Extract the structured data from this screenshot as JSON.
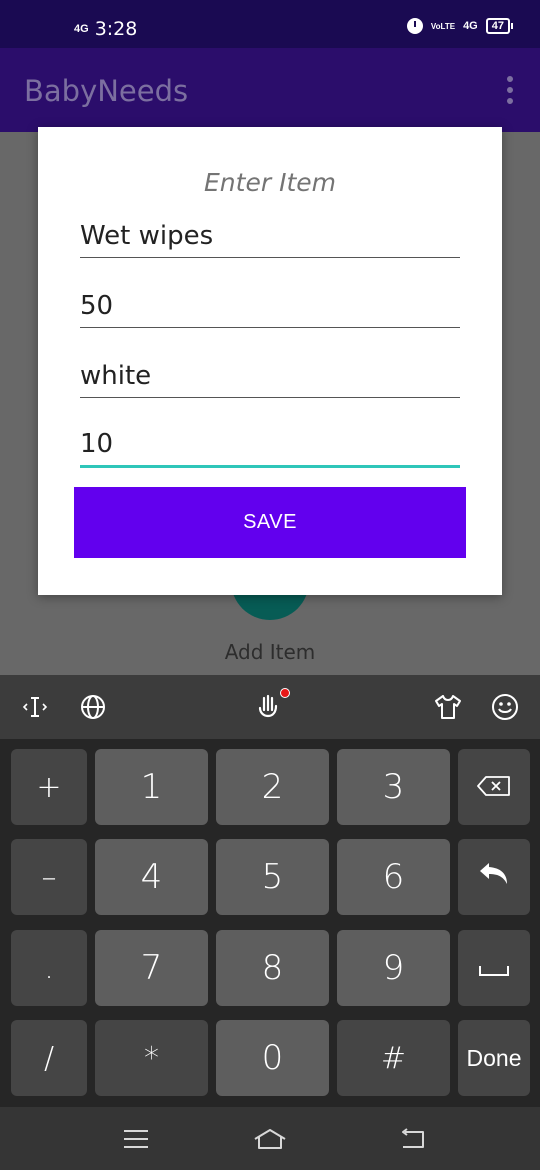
{
  "status_bar": {
    "network_left": "4G",
    "time": "3:28",
    "volte": "VoLTE",
    "network_right": "4G",
    "battery": "47"
  },
  "app_bar": {
    "title": "BabyNeeds"
  },
  "background": {
    "add_item_label": "Add Item"
  },
  "dialog": {
    "title": "Enter Item",
    "fields": [
      {
        "value": "Wet wipes"
      },
      {
        "value": "50"
      },
      {
        "value": "white"
      },
      {
        "value": "10"
      }
    ],
    "save_label": "SAVE"
  },
  "keyboard": {
    "side_left": [
      "+",
      "–",
      ".",
      "/"
    ],
    "numbers": [
      "1",
      "2",
      "3",
      "4",
      "5",
      "6",
      "7",
      "8",
      "9",
      "*",
      "0",
      "#"
    ],
    "done_label": "Done"
  },
  "colors": {
    "status_bar": "#1a0a52",
    "app_bar": "#2b0d6b",
    "save_button": "#6200ee",
    "focus_underline": "#2fc6b9",
    "fab": "#075c55"
  },
  "icons": {
    "toolbar": [
      "text-cursor-icon",
      "globe-icon",
      "voice-hand-icon",
      "theme-shirt-icon",
      "emoji-icon"
    ],
    "keyboard": [
      "backspace-icon",
      "enter-icon",
      "space-icon"
    ],
    "nav": [
      "menu-icon",
      "home-icon",
      "back-icon"
    ]
  }
}
